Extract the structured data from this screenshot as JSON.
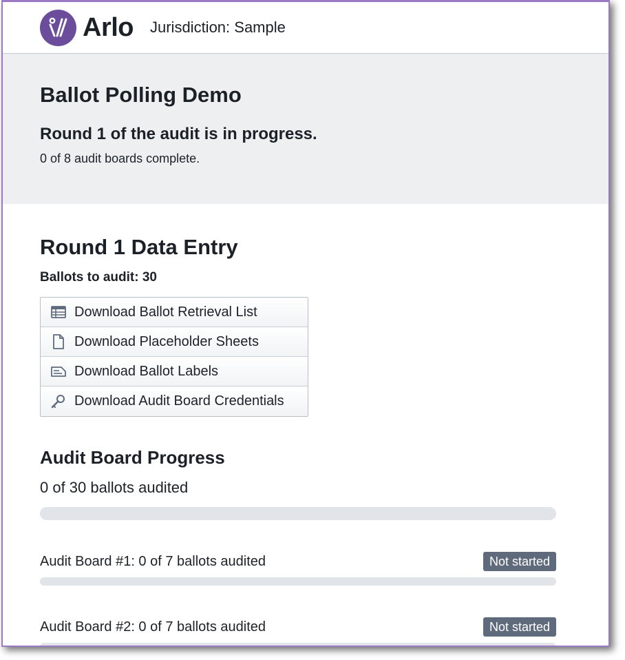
{
  "app": {
    "logo_text": "Arlo",
    "jurisdiction": "Jurisdiction: Sample",
    "brand_color": "#6b4d9b"
  },
  "banner": {
    "title": "Ballot Polling Demo",
    "status": "Round 1 of the audit is in progress.",
    "detail": "0 of 8 audit boards complete."
  },
  "data_entry": {
    "title": "Round 1 Data Entry",
    "ballots_to_audit": "Ballots to audit: 30",
    "buttons": [
      {
        "label": "Download Ballot Retrieval List",
        "icon": "th-table-icon"
      },
      {
        "label": "Download Placeholder Sheets",
        "icon": "document-icon"
      },
      {
        "label": "Download Ballot Labels",
        "icon": "label-icon"
      },
      {
        "label": "Download Audit Board Credentials",
        "icon": "key-icon"
      }
    ]
  },
  "progress": {
    "title": "Audit Board Progress",
    "overall_text": "0 of 30 ballots audited",
    "overall_fraction": 0,
    "boards": [
      {
        "label": "Audit Board #1: 0 of 7 ballots audited",
        "status": "Not started",
        "fraction": 0
      },
      {
        "label": "Audit Board #2: 0 of 7 ballots audited",
        "status": "Not started",
        "fraction": 0
      }
    ]
  }
}
